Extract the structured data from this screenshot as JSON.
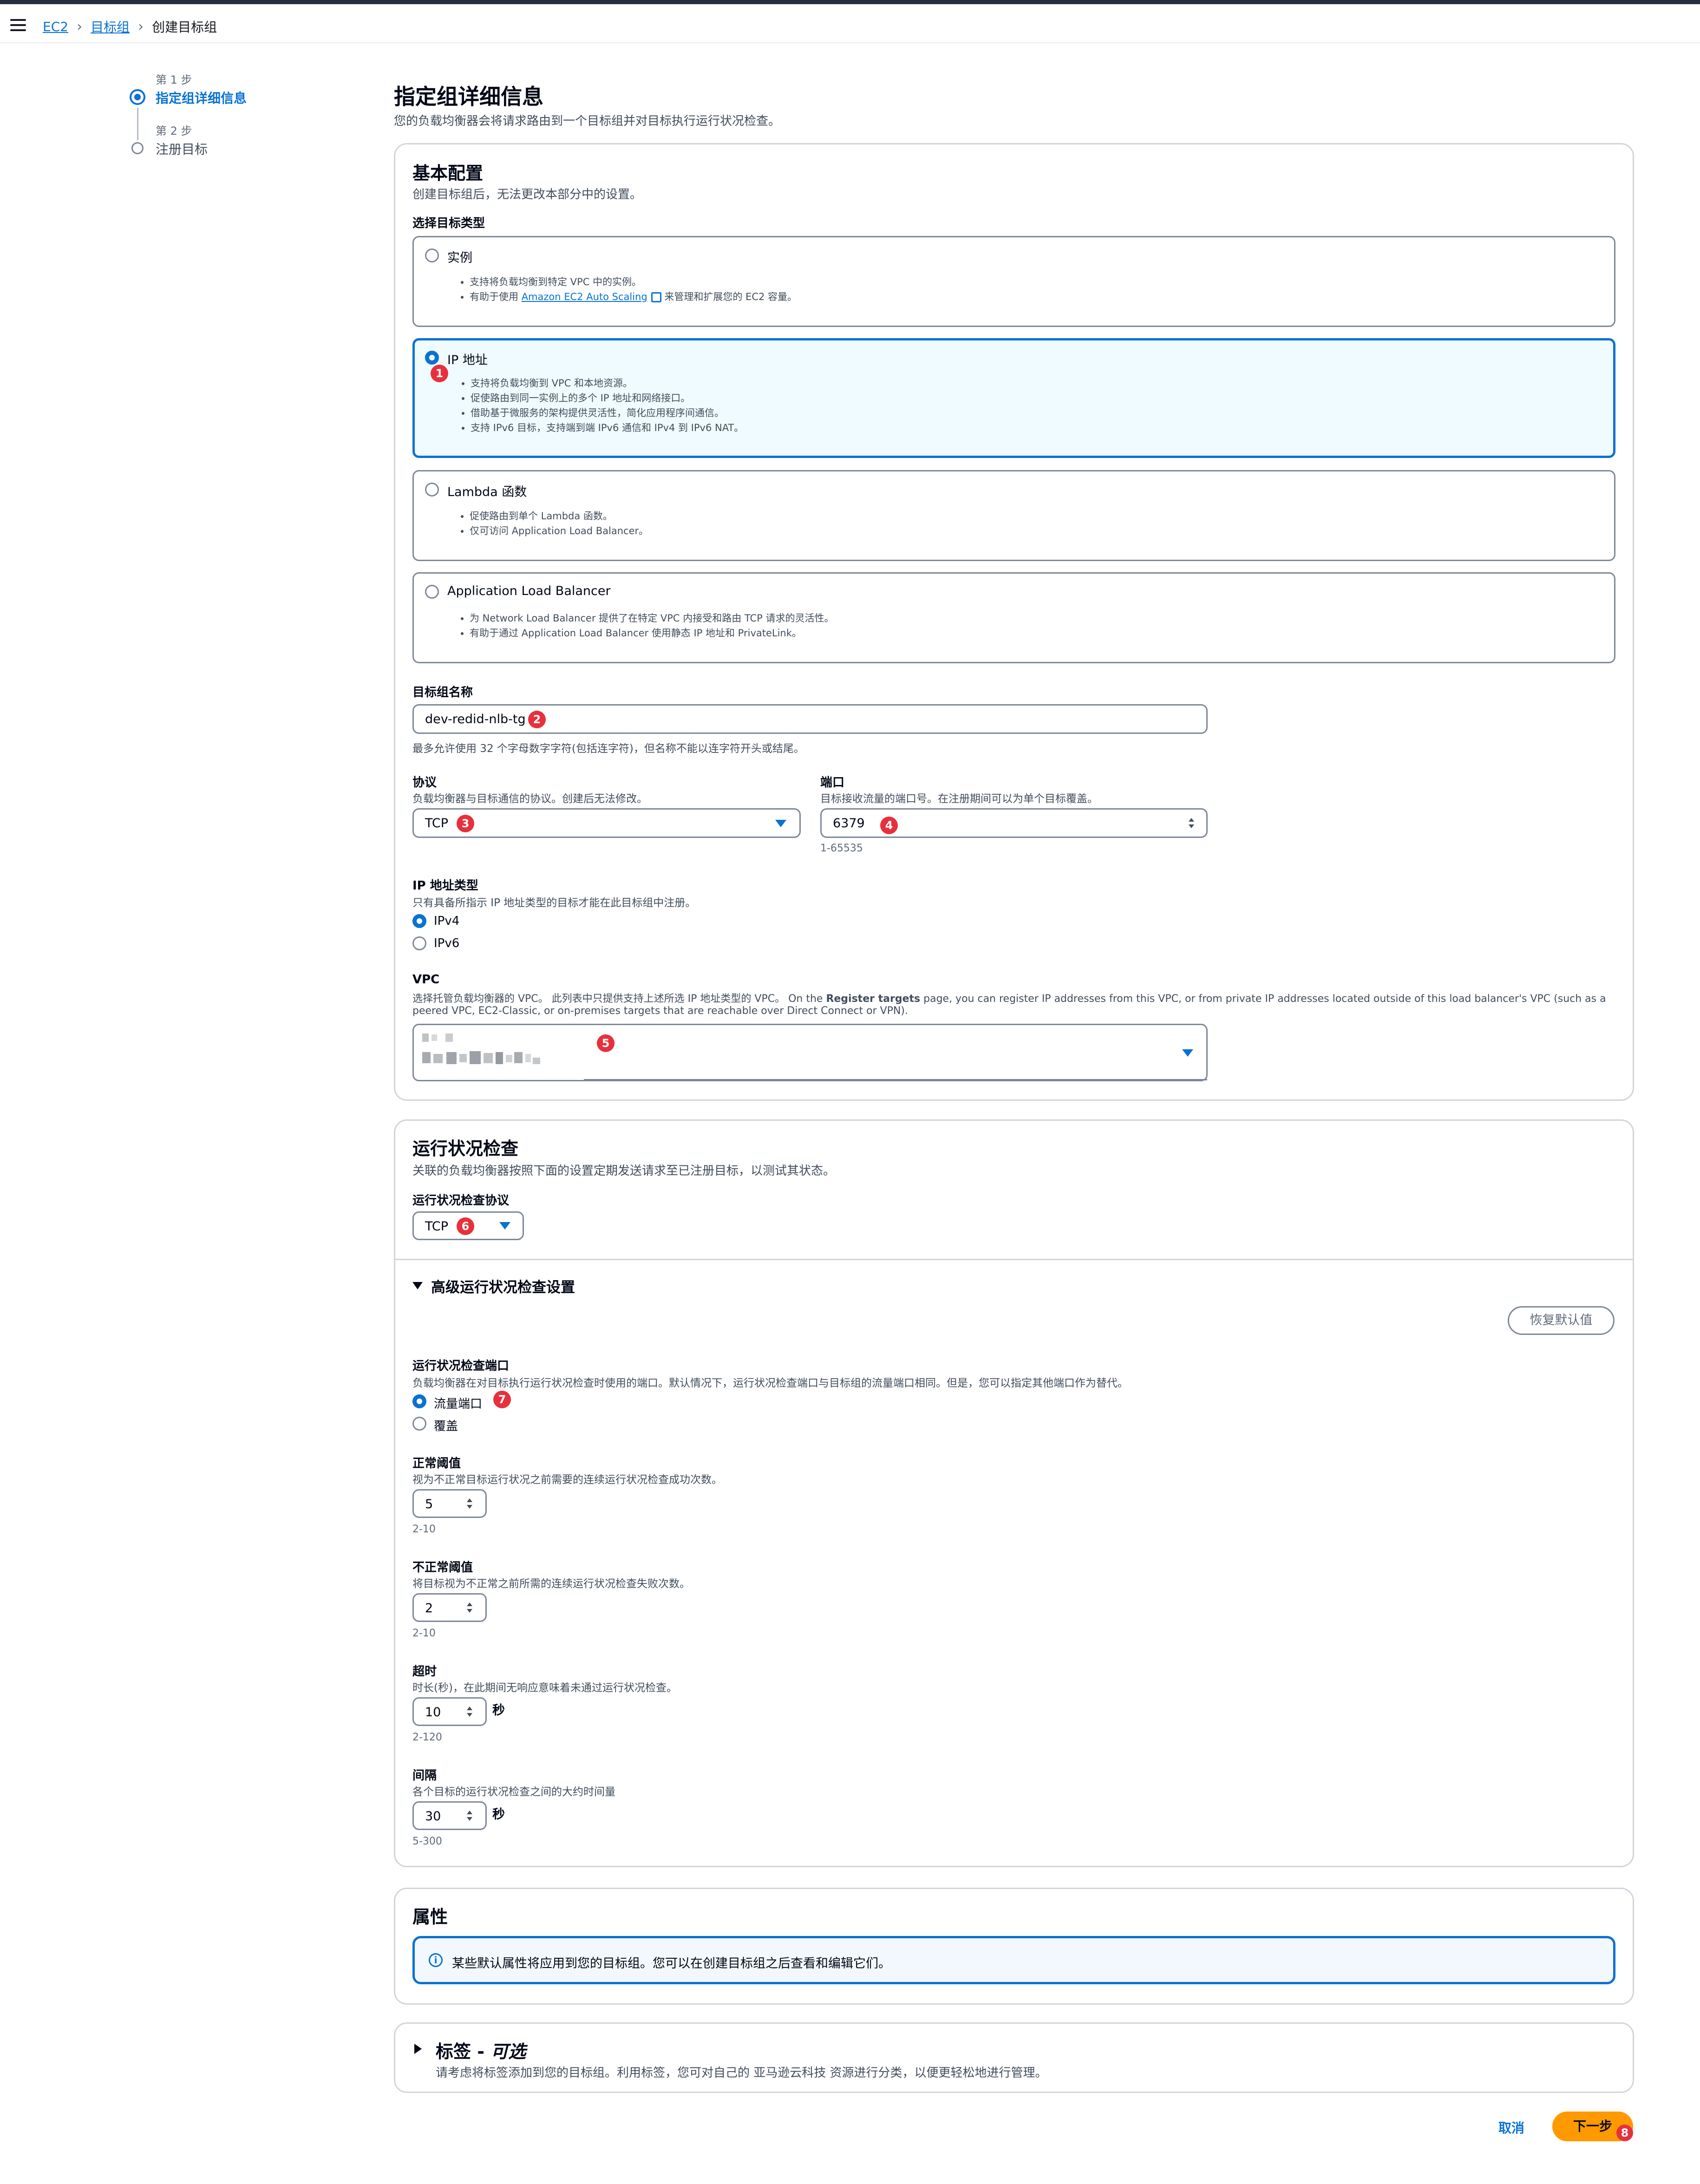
{
  "breadcrumb": {
    "ec2": "EC2",
    "target_groups": "目标组",
    "current": "创建目标组"
  },
  "steps": [
    {
      "label": "第 1 步",
      "title": "指定组详细信息"
    },
    {
      "label": "第 2 步",
      "title": "注册目标"
    }
  ],
  "page": {
    "title": "指定组详细信息",
    "description": "您的负载均衡器会将请求路由到一个目标组并对目标执行运行状况检查。"
  },
  "basic": {
    "title": "基本配置",
    "description": "创建目标组后，无法更改本部分中的设置。",
    "target_type_label": "选择目标类型",
    "types": [
      {
        "title": "实例",
        "selected": false,
        "bullets": [
          "支持将负载均衡到特定 VPC 中的实例。"
        ],
        "bullet2_prefix": "有助于使用 ",
        "bullet2_link": "Amazon EC2 Auto Scaling",
        "bullet2_suffix": " 来管理和扩展您的 EC2 容量。"
      },
      {
        "title": "IP 地址",
        "selected": true,
        "bullets": [
          "支持将负载均衡到 VPC 和本地资源。",
          "促使路由到同一实例上的多个 IP 地址和网络接口。",
          "借助基于微服务的架构提供灵活性，简化应用程序间通信。",
          "支持 IPv6 目标，支持端到端 IPv6 通信和 IPv4 到 IPv6 NAT。"
        ]
      },
      {
        "title": "Lambda 函数",
        "selected": false,
        "bullets": [
          "促使路由到单个 Lambda 函数。",
          "仅可访问 Application Load Balancer。"
        ]
      },
      {
        "title": "Application Load Balancer",
        "selected": false,
        "bullets": [
          "为 Network Load Balancer 提供了在特定 VPC 内接受和路由 TCP 请求的灵活性。",
          "有助于通过 Application Load Balancer 使用静态 IP 地址和 PrivateLink。"
        ]
      }
    ],
    "name_label": "目标组名称",
    "name_value": "dev-redid-nlb-tg",
    "name_hint": "最多允许使用 32 个字母数字字符(包括连字符)，但名称不能以连字符开头或结尾。",
    "protocol_label": "协议",
    "protocol_desc": "负载均衡器与目标通信的协议。创建后无法修改。",
    "protocol_value": "TCP",
    "port_label": "端口",
    "port_desc": "目标接收流量的端口号。在注册期间可以为单个目标覆盖。",
    "port_value": "6379",
    "port_hint": "1-65535",
    "ip_type_label": "IP 地址类型",
    "ip_type_desc": "只有具备所指示 IP 地址类型的目标才能在此目标组中注册。",
    "ip_types": [
      {
        "label": "IPv4",
        "selected": true
      },
      {
        "label": "IPv6",
        "selected": false
      }
    ],
    "vpc_label": "VPC",
    "vpc_desc_1": "选择托管负载均衡器的 VPC。 此列表中只提供支持上述所选 IP 地址类型的 VPC。 On the ",
    "vpc_desc_bold": "Register targets",
    "vpc_desc_2": " page, you can register IP addresses from this VPC, or from private IP addresses located outside of this load balancer's VPC (such as a",
    "vpc_desc_3": "peered VPC, EC2-Classic, or on-premises targets that are reachable over Direct Connect or VPN)."
  },
  "health": {
    "title": "运行状况检查",
    "description": "关联的负载均衡器按照下面的设置定期发送请求至已注册目标，以测试其状态。",
    "protocol_label": "运行状况检查协议",
    "protocol_value": "TCP",
    "advanced_title": "高级运行状况检查设置",
    "restore_defaults": "恢复默认值",
    "port_label": "运行状况检查端口",
    "port_desc": "负载均衡器在对目标执行运行状况检查时使用的端口。默认情况下，运行状况检查端口与目标组的流量端口相同。但是，您可以指定其他端口作为替代。",
    "port_options": [
      {
        "label": "流量端口",
        "selected": true
      },
      {
        "label": "覆盖",
        "selected": false
      }
    ],
    "healthy_label": "正常阈值",
    "healthy_desc": "视为不正常目标运行状况之前需要的连续运行状况检查成功次数。",
    "healthy_value": "5",
    "healthy_hint": "2-10",
    "unhealthy_label": "不正常阈值",
    "unhealthy_desc": "将目标视为不正常之前所需的连续运行状况检查失败次数。",
    "unhealthy_value": "2",
    "unhealthy_hint": "2-10",
    "timeout_label": "超时",
    "timeout_desc": "时长(秒)，在此期间无响应意味着未通过运行状况检查。",
    "timeout_value": "10",
    "timeout_unit": "秒",
    "timeout_hint": "2-120",
    "interval_label": "间隔",
    "interval_desc": "各个目标的运行状况检查之间的大约时间量",
    "interval_value": "30",
    "interval_unit": "秒",
    "interval_hint": "5-300"
  },
  "attributes": {
    "title": "属性",
    "info": "某些默认属性将应用到您的目标组。您可以在创建目标组之后查看和编辑它们。"
  },
  "tags": {
    "title": "标签 - ",
    "optional": "可选",
    "description": "请考虑将标签添加到您的目标组。利用标签，您可对自己的 亚马逊云科技 资源进行分类，以便更轻松地进行管理。"
  },
  "footer": {
    "cancel": "取消",
    "next": "下一步"
  },
  "annotations": [
    "1",
    "2",
    "3",
    "4",
    "5",
    "6",
    "7",
    "8"
  ],
  "colors": {
    "accent": "#0972d3",
    "primary_button": "#ff9900",
    "badge": "#e8303c"
  }
}
